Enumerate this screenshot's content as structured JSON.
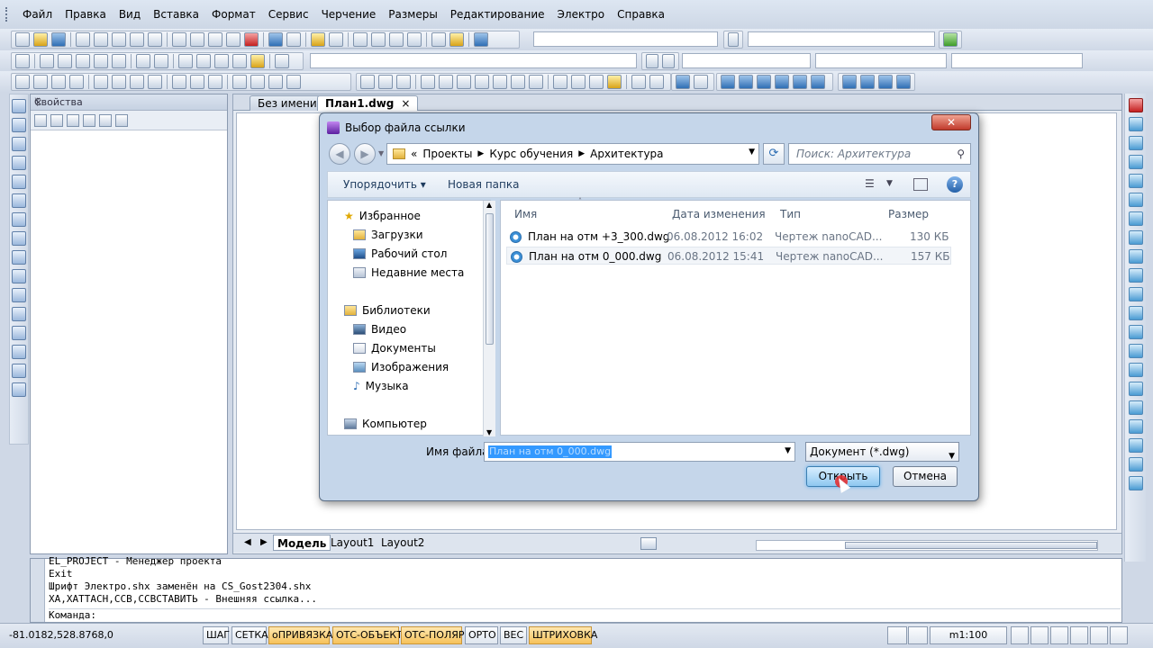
{
  "menu": [
    "Файл",
    "Правка",
    "Вид",
    "Вставка",
    "Формат",
    "Сервис",
    "Черчение",
    "Размеры",
    "Редактирование",
    "Электро",
    "Справка"
  ],
  "properties": {
    "title": "Свойства"
  },
  "doc_tabs": [
    "Без имени0",
    "План1.dwg"
  ],
  "layout_tabs": [
    "Модель",
    "Layout1",
    "Layout2"
  ],
  "command_log": [
    "EL_PROJECT - Менеджер проекта",
    "Exit",
    "Шрифт Электро.shx заменён на CS_Gost2304.shx",
    "ХА,ХАТТАСН,ССВ,ССВСТАВИТЬ - Внешняя ссылка..."
  ],
  "command_prompt": "Команда:",
  "status": {
    "coords": "-81.0182,528.8768,0",
    "toggles": [
      {
        "label": "ШАГ",
        "on": false
      },
      {
        "label": "СЕТКА",
        "on": false
      },
      {
        "label": "оПРИВЯЗКА",
        "on": true
      },
      {
        "label": "ОТС-ОБЪЕКТ",
        "on": true
      },
      {
        "label": "ОТС-ПОЛЯР",
        "on": true
      },
      {
        "label": "ОРТО",
        "on": false
      },
      {
        "label": "ВЕС",
        "on": false
      },
      {
        "label": "ШТРИХОВКА",
        "on": true
      }
    ],
    "scale": "m1:100"
  },
  "dialog": {
    "title": "Выбор файла ссылки",
    "breadcrumbs": [
      "«",
      "Проекты",
      "Курс обучения",
      "Архитектура"
    ],
    "search_placeholder": "Поиск: Архитектура",
    "organize": "Упорядочить",
    "new_folder": "Новая папка",
    "nav": {
      "favorites": "Избранное",
      "fav_items": [
        "Загрузки",
        "Рабочий стол",
        "Недавние места"
      ],
      "libraries": "Библиотеки",
      "lib_items": [
        "Видео",
        "Документы",
        "Изображения",
        "Музыка"
      ],
      "computer": "Компьютер"
    },
    "columns": [
      "Имя",
      "Дата изменения",
      "Тип",
      "Размер"
    ],
    "files": [
      {
        "name": "План на отм +3_300.dwg",
        "date": "06.08.2012 16:02",
        "type": "Чертеж nanoCAD...",
        "size": "130 КБ"
      },
      {
        "name": "План на отм 0_000.dwg",
        "date": "06.08.2012 15:41",
        "type": "Чертеж nanoCAD...",
        "size": "157 КБ"
      }
    ],
    "filename_label": "Имя файла:",
    "filename_value": "План на отм 0_000.dwg",
    "filetype": "Документ (*.dwg)",
    "open": "Открыть",
    "cancel": "Отмена"
  },
  "colors": {
    "accent": "#3399ff",
    "status_on": "#f6c25b"
  }
}
